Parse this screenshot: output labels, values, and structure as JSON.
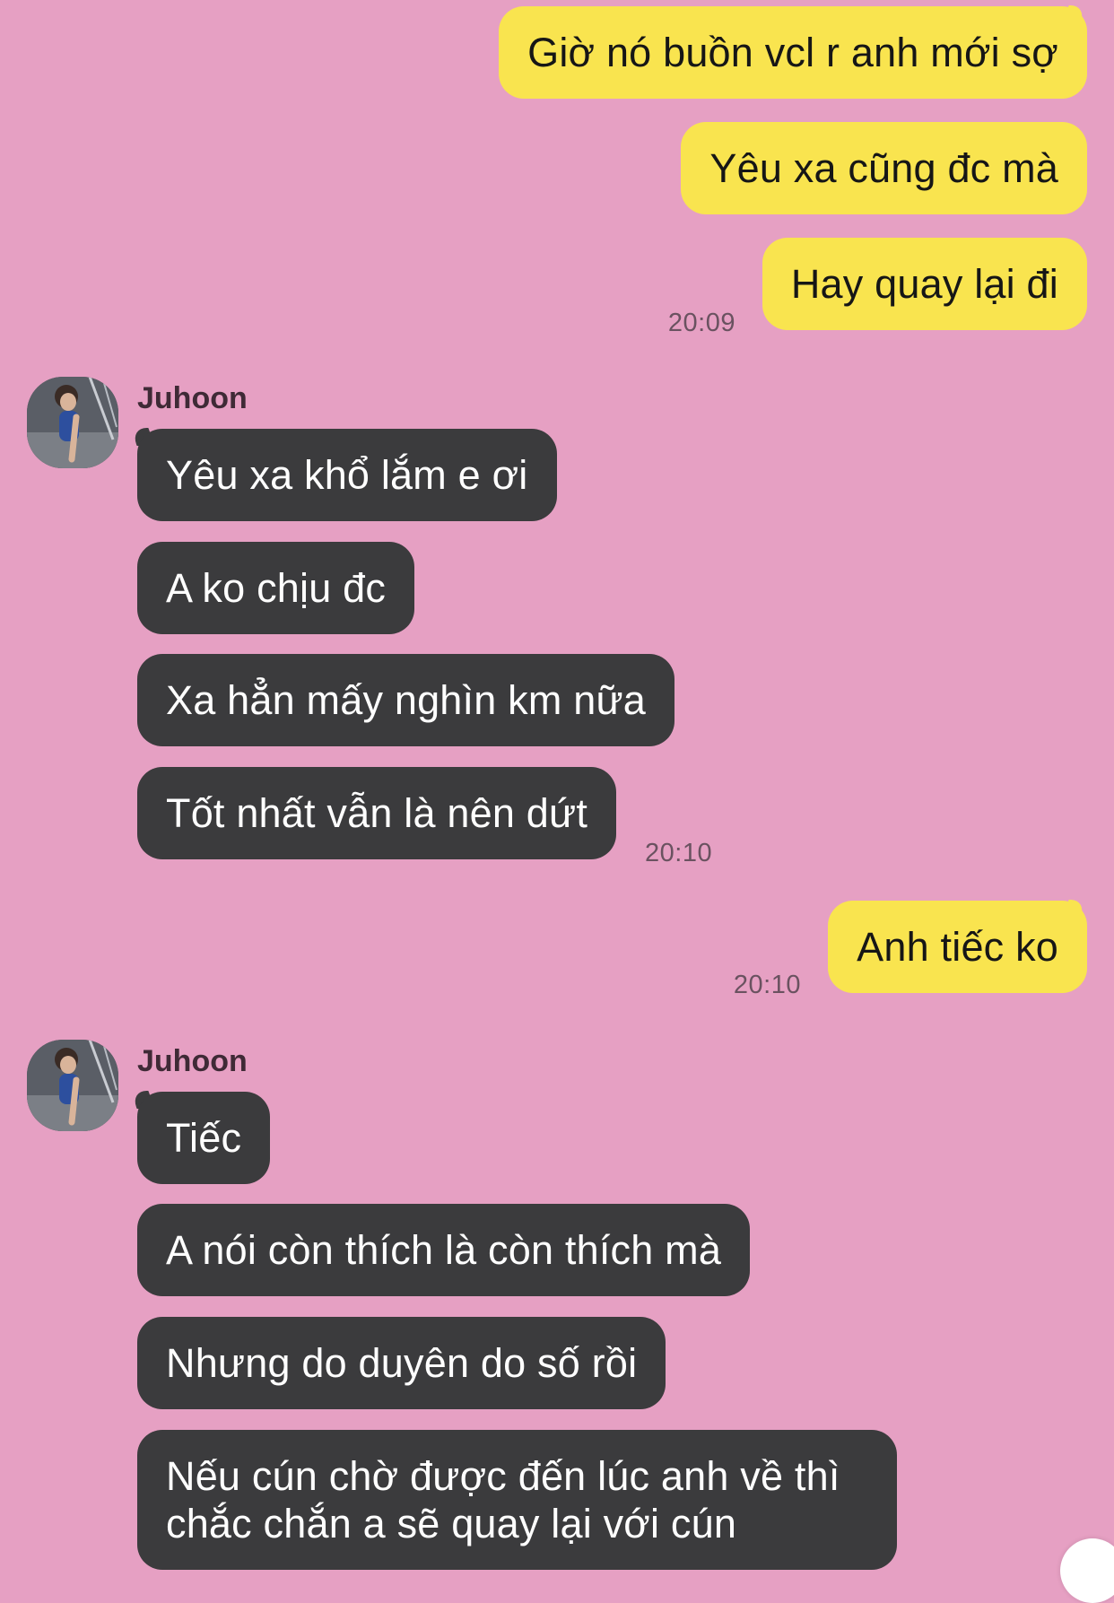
{
  "chat": {
    "messages": [
      {
        "direction": "outgoing",
        "text": "Giờ nó buồn vcl r anh mới sợ"
      },
      {
        "direction": "outgoing",
        "text": "Yêu xa cũng đc mà"
      },
      {
        "direction": "outgoing",
        "text": "Hay quay lại đi",
        "time": "20:09"
      },
      {
        "direction": "incoming",
        "sender": "Juhoon",
        "text": "Yêu xa khổ lắm e ơi"
      },
      {
        "direction": "incoming",
        "text": "A ko chịu đc"
      },
      {
        "direction": "incoming",
        "text": "Xa hẳn mấy nghìn km nữa"
      },
      {
        "direction": "incoming",
        "text": "Tốt nhất vẫn là nên dứt",
        "time": "20:10"
      },
      {
        "direction": "outgoing",
        "text": "Anh tiếc ko",
        "time": "20:10"
      },
      {
        "direction": "incoming",
        "sender": "Juhoon",
        "text": "Tiếc"
      },
      {
        "direction": "incoming",
        "text": "A nói còn thích là còn thích mà"
      },
      {
        "direction": "incoming",
        "text": "Nhưng do duyên do số rồi"
      },
      {
        "direction": "incoming",
        "text": "Nếu cún chờ được đến lúc anh về thì chắc chắn a sẽ quay lại với cún"
      }
    ]
  },
  "colors": {
    "background": "#e6a0c3",
    "outgoing_bubble": "#f9e44f",
    "incoming_bubble": "#3b3b3d",
    "timestamp": "#6a5260"
  },
  "icons": {
    "avatar": "contact-avatar-photo"
  }
}
